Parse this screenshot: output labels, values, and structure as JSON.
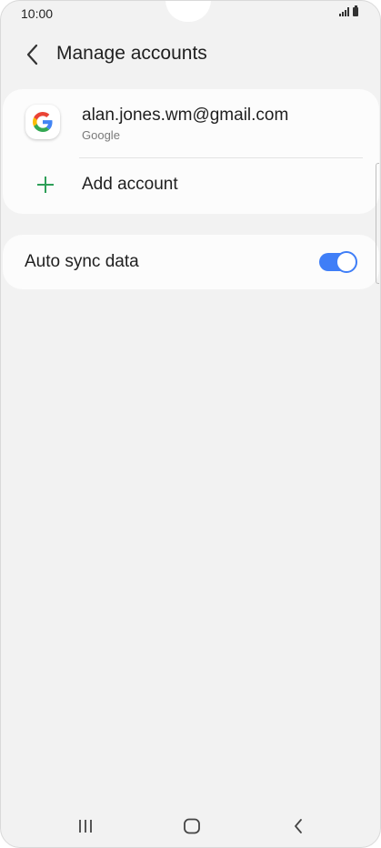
{
  "status_bar": {
    "time": "10:00",
    "signal_icon": "signal-icon",
    "battery_icon": "battery-icon"
  },
  "header": {
    "back_icon": "chevron-left-icon",
    "title": "Manage accounts"
  },
  "accounts": [
    {
      "email": "alan.jones.wm@gmail.com",
      "type": "Google",
      "icon": "google-icon"
    }
  ],
  "add_account": {
    "label": "Add account",
    "icon": "plus-icon",
    "icon_color": "#2e9f58"
  },
  "auto_sync": {
    "label": "Auto sync data",
    "enabled": true,
    "accent_color": "#3f7ef7"
  },
  "nav_bar": {
    "recents_icon": "recents-icon",
    "home_icon": "home-icon",
    "back_icon": "back-icon"
  }
}
